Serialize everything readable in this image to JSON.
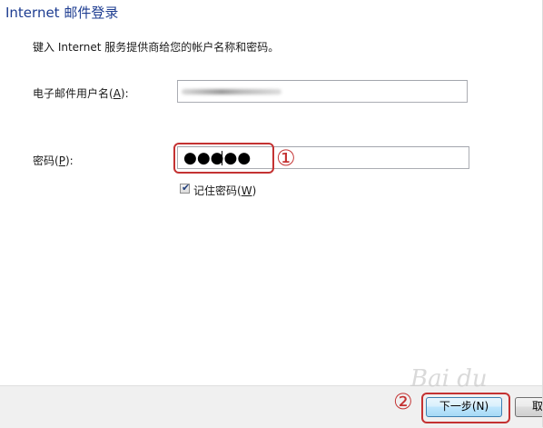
{
  "dialog": {
    "title": "Internet 邮件登录",
    "description": "键入 Internet 服务提供商给您的帐户名称和密码。"
  },
  "form": {
    "username_label_prefix": "电子邮件用户名(",
    "username_label_accel": "A",
    "username_label_suffix": "):",
    "password_label_prefix": "密码(",
    "password_label_accel": "P",
    "password_label_suffix": "):",
    "password_masked": "●●●●●",
    "remember_label_prefix": "记住密码(",
    "remember_label_accel": "W",
    "remember_label_suffix": ")",
    "remember_checked": true
  },
  "annotations": {
    "step1": "①",
    "step2": "②"
  },
  "buttons": {
    "next_label": "下一步(N)",
    "cancel_label": "取"
  },
  "watermark": "Bai du"
}
